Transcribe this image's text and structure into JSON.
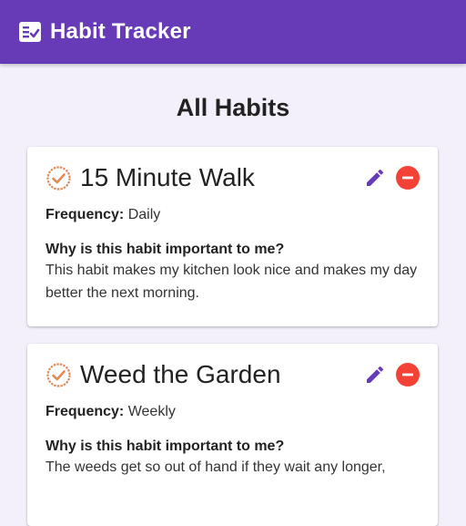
{
  "app": {
    "title": "Habit Tracker",
    "logo_icon": "checklist-icon",
    "bar_color": "#673ab7"
  },
  "page": {
    "title": "All Habits"
  },
  "habits": [
    {
      "name": "15 Minute Walk",
      "frequency_label": "Frequency:",
      "frequency": "Daily",
      "why_label": "Why is this habit important to me?",
      "why_text": "This habit makes my kitchen look nice and makes my day better the next morning."
    },
    {
      "name": "Weed the Garden",
      "frequency_label": "Frequency:",
      "frequency": "Weekly",
      "why_label": "Why is this habit important to me?",
      "why_text": "The weeds get so out of hand if they wait any longer,"
    }
  ],
  "icons": {
    "habit": "check-circle-icon",
    "edit": "pencil-icon",
    "delete": "minus-circle-icon"
  },
  "colors": {
    "edit": "#673ab7",
    "delete": "#f44336",
    "check": "#e08a5a"
  }
}
